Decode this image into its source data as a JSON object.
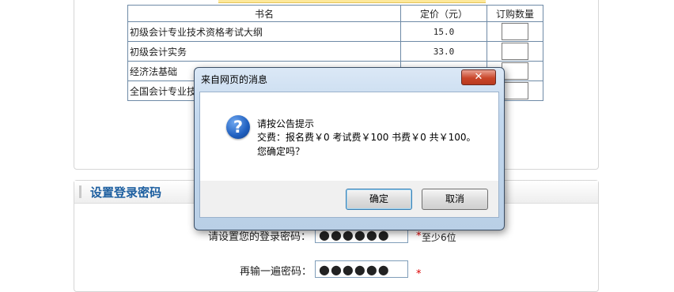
{
  "book_table": {
    "headers": {
      "name": "书名",
      "price": "定价（元）",
      "qty": "订购数量"
    },
    "rows": [
      {
        "name": "初级会计专业技术资格考试大纲",
        "price": "15.0"
      },
      {
        "name": "初级会计实务",
        "price": "33.0"
      },
      {
        "name": "经济法基础",
        "price": ""
      },
      {
        "name": "全国会计专业技",
        "price": ""
      }
    ]
  },
  "password_section": {
    "title": "设置登录密码",
    "password_label": "请设置您的登录密码：",
    "password_value": "●●●●●●",
    "password_required": "*",
    "password_hint": "至少6位",
    "confirm_label": "再输一遍密码：",
    "confirm_value": "●●●●●●",
    "confirm_required": "*"
  },
  "dialog": {
    "title": "来自网页的消息",
    "close_symbol": "✕",
    "icon": "question-icon",
    "line1": "请按公告提示",
    "line2": "交费：报名费￥0 考试费￥100 书费￥0 共￥100。",
    "line3": "您确定吗？",
    "ok_label": "确定",
    "cancel_label": "取消"
  }
}
